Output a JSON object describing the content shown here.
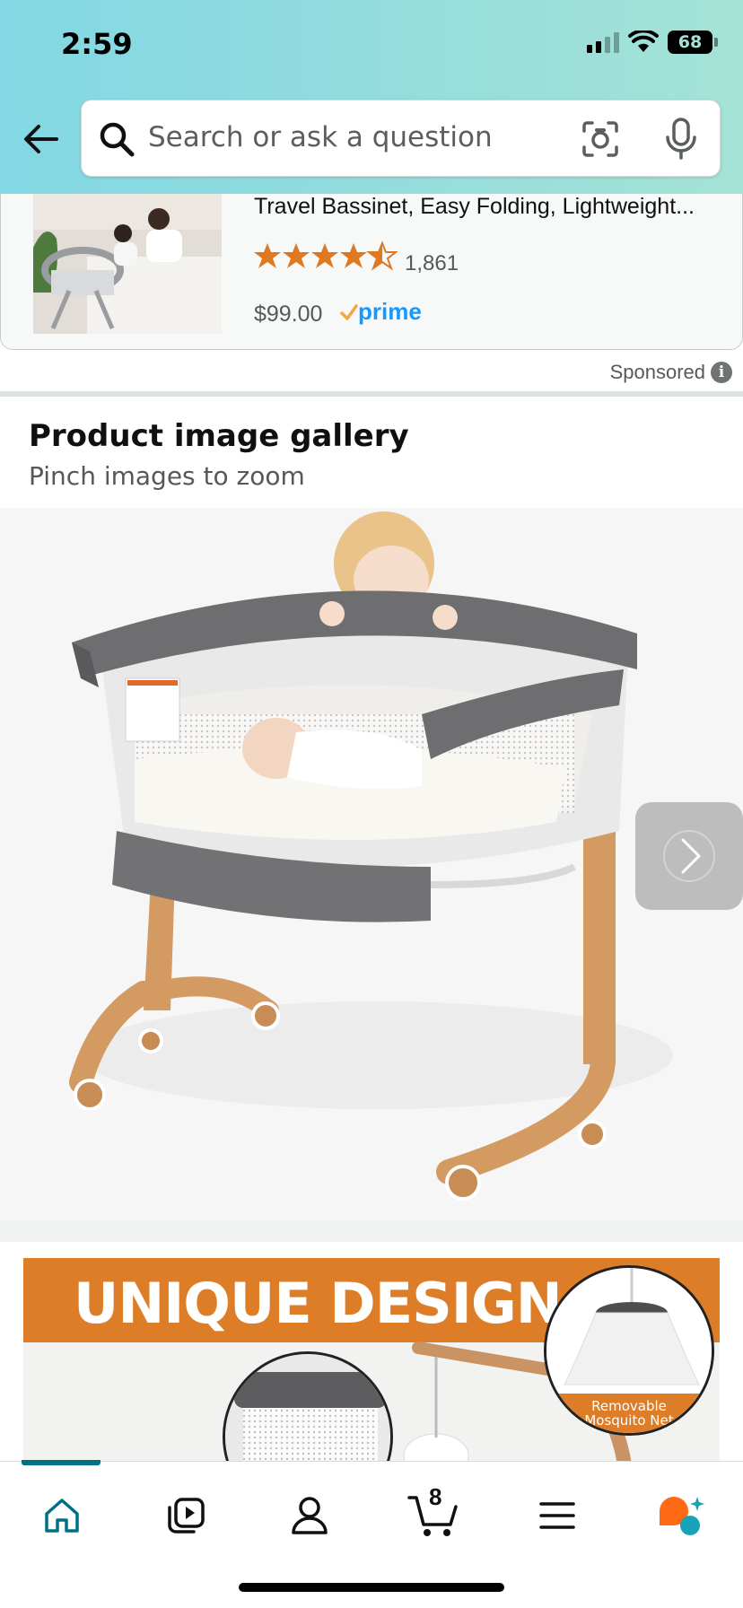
{
  "status_bar": {
    "time": "2:59",
    "battery": "68"
  },
  "search": {
    "placeholder": "Search or ask a question"
  },
  "sponsored_product": {
    "title": "Travel Bassinet, Easy Folding, Lightweight...",
    "rating": 4.5,
    "rating_count": "1,861",
    "price": "$99.00",
    "prime_label": "prime"
  },
  "sponsored": {
    "label": "Sponsored",
    "info_glyph": "i"
  },
  "gallery": {
    "title": "Product image gallery",
    "subtitle": "Pinch images to zoom"
  },
  "banner": {
    "title": "UNIQUE DESIGN",
    "net_label_line1": "Removable",
    "net_label_line2": "Mosquito Net"
  },
  "tab_bar": {
    "cart_count": "8",
    "active_tab": "home",
    "accent_color": "#007185"
  },
  "colors": {
    "header_gradient_start": "#82d8e3",
    "header_gradient_end": "#a5e3d5",
    "star": "#de7921",
    "prime_blue": "#1399ff",
    "banner_orange": "#dd7d27"
  }
}
